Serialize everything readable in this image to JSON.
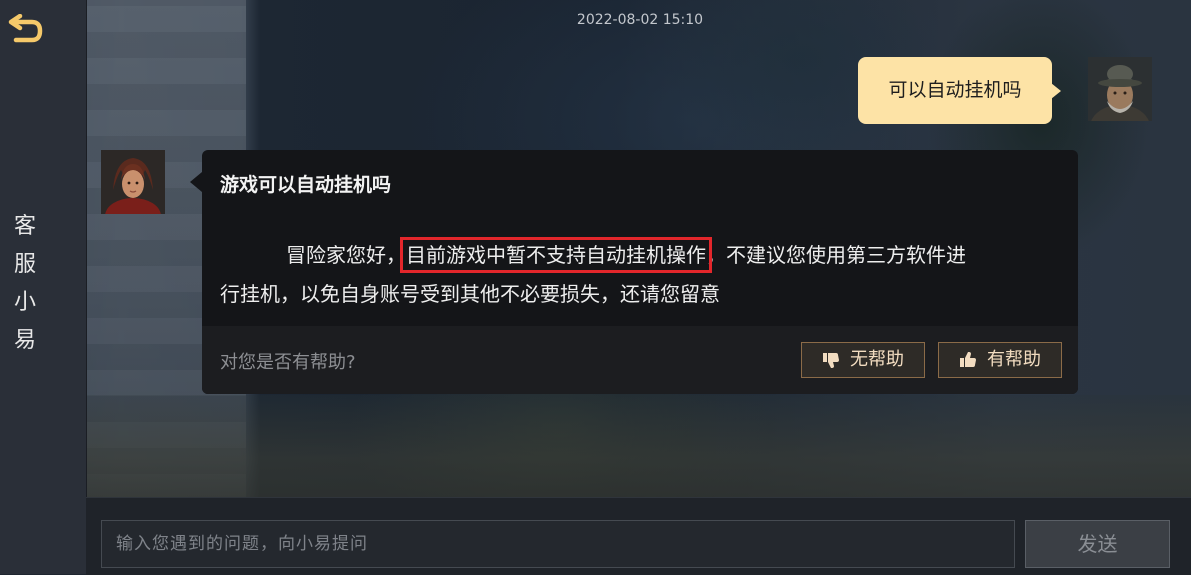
{
  "sidebar": {
    "title_chars": [
      "客",
      "服",
      "小",
      "易"
    ]
  },
  "chat": {
    "timestamp": "2022-08-02 15:10",
    "user_message": "可以自动挂机吗",
    "agent_reply": {
      "title": "游戏可以自动挂机吗",
      "body_line1_pre": "冒险家您好，",
      "body_line1_highlight": "目前游戏中暂不支持自动挂机操作",
      "body_line1_post": "，不建议您使用第三方软件进",
      "body_line2": "行挂机，以免自身账号受到其他不必要损失，还请您留意",
      "feedback_question": "对您是否有帮助?",
      "not_helpful_label": "无帮助",
      "helpful_label": "有帮助"
    }
  },
  "input": {
    "placeholder": "输入您遇到的问题，向小易提问",
    "value": "",
    "send_label": "发送"
  },
  "colors": {
    "user_bubble": "#fde3a6",
    "highlight_border": "#e3262b",
    "feedback_button_border": "#8b6b48",
    "back_icon": "#f5c96a"
  },
  "icons": {
    "back": "return-arrow-icon",
    "not_helpful": "thumbs-down-icon",
    "helpful": "thumbs-up-icon"
  }
}
